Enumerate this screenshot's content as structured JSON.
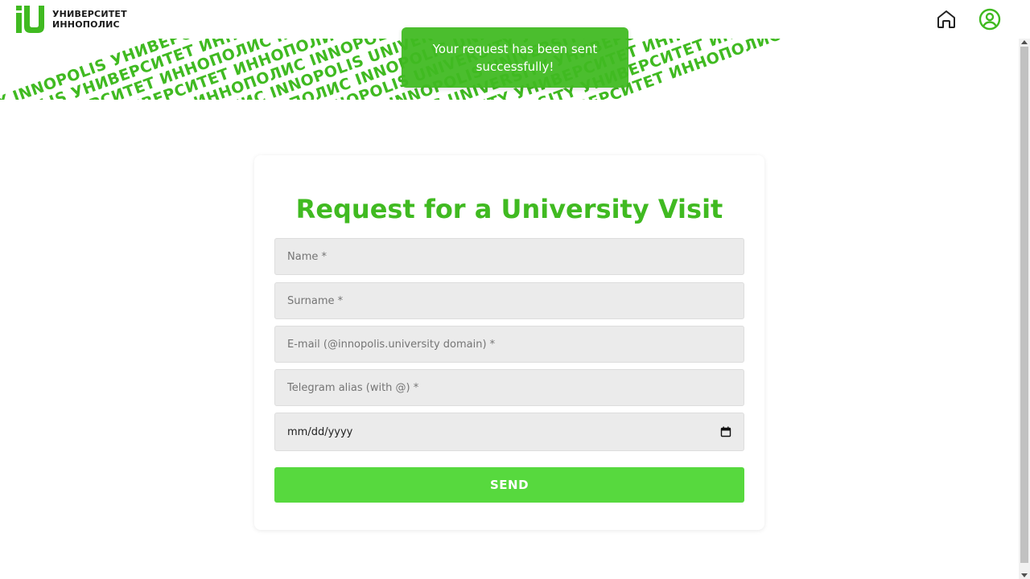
{
  "header": {
    "logo_line1": "УНИВЕРСИТЕТ",
    "logo_line2": "ИННОПОЛИС",
    "icons": [
      "home-icon",
      "user-profile-icon"
    ],
    "accent_color": "#40ba21"
  },
  "banner": {
    "pattern_text": "UNIVERSITY INNOPOLIS УНИВЕРСИТЕТ ИННОПОЛИС INNOPOLIS UNIVERSITY УНИВЕРСИТЕТ ИННОПОЛИС UNIVERSITY INNOPOLIS УНИВЕРСИТЕТ ИННОПОЛИС INNOPOLIS UNIVERSITY УНИВЕРСИТЕТ ИННОПОЛИС"
  },
  "toast": {
    "message": "Your request has been sent successfully!"
  },
  "form": {
    "title": "Request for a University Visit",
    "name_placeholder": "Name *",
    "surname_placeholder": "Surname *",
    "email_placeholder": "E-mail (@innopolis.university domain) *",
    "telegram_placeholder": "Telegram alias (with @) *",
    "date_placeholder": "mm/dd/yyyy",
    "send_label": "SEND",
    "button_color": "#57d93e"
  }
}
